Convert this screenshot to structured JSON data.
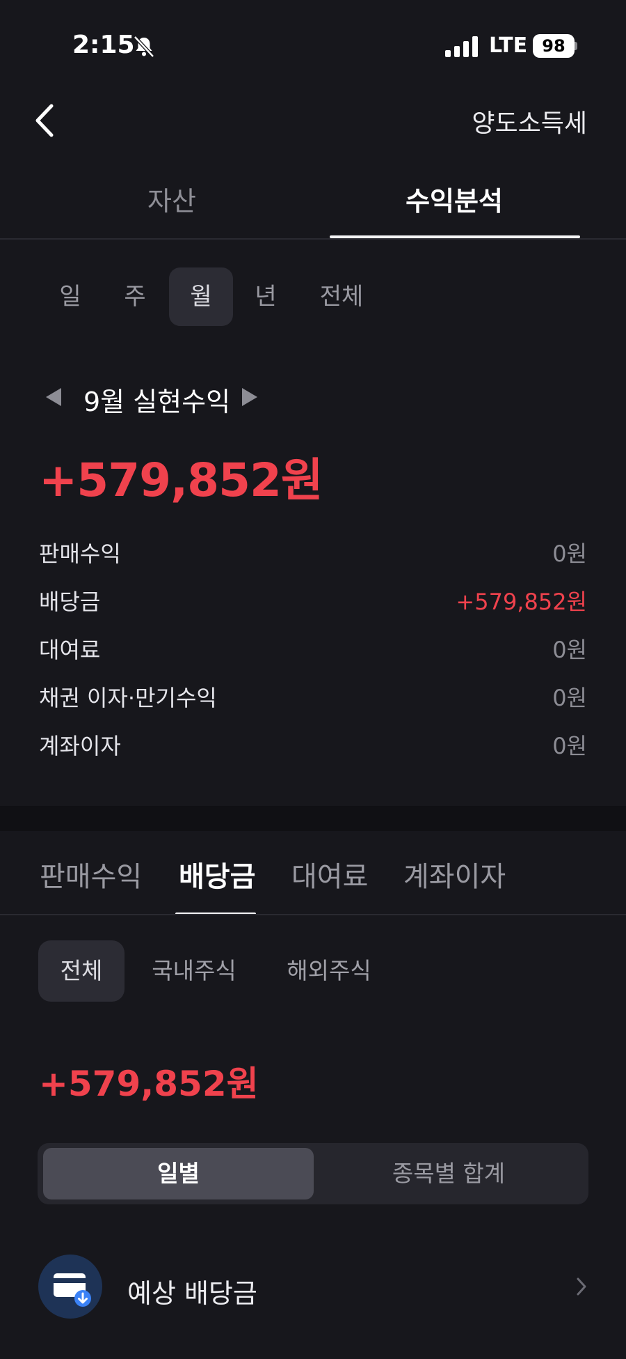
{
  "status_bar": {
    "time": "2:15",
    "network": "LTE",
    "battery": "98",
    "icons": [
      "bell-off-icon",
      "signal-icon"
    ]
  },
  "header": {
    "right_title": "양도소득세",
    "back_icon": "chevron-left-icon"
  },
  "main_tabs": [
    {
      "label": "자산",
      "active": false
    },
    {
      "label": "수익분석",
      "active": true
    }
  ],
  "periods": [
    {
      "label": "일",
      "active": false
    },
    {
      "label": "주",
      "active": false
    },
    {
      "label": "월",
      "active": true
    },
    {
      "label": "년",
      "active": false
    },
    {
      "label": "전체",
      "active": false
    }
  ],
  "summary": {
    "month_label": "9월 실현수익",
    "total": "+579,852원",
    "rows": [
      {
        "label": "판매수익",
        "value": "0원"
      },
      {
        "label": "배당금",
        "value": "+579,852원"
      },
      {
        "label": "대여료",
        "value": "0원"
      },
      {
        "label": "채권 이자·만기수익",
        "value": "0원"
      },
      {
        "label": "계좌이자",
        "value": "0원"
      }
    ]
  },
  "sub_tabs": [
    {
      "label": "판매수익",
      "active": false
    },
    {
      "label": "배당금",
      "active": true
    },
    {
      "label": "대여료",
      "active": false
    },
    {
      "label": "계좌이자",
      "active": false
    }
  ],
  "markets": [
    {
      "label": "전체",
      "active": true
    },
    {
      "label": "국내주식",
      "active": false
    },
    {
      "label": "해외주식",
      "active": false
    }
  ],
  "dividend": {
    "amount": "+579,852원",
    "segments": [
      {
        "label": "일별",
        "active": true
      },
      {
        "label": "종목별 합계",
        "active": false
      }
    ],
    "expected_label": "예상 배당금"
  },
  "colors": {
    "background": "#17171c",
    "positive": "#f0424d",
    "muted": "#8d8d95",
    "icon_circle": "#1e3356",
    "icon_accent": "#3b82f6"
  }
}
